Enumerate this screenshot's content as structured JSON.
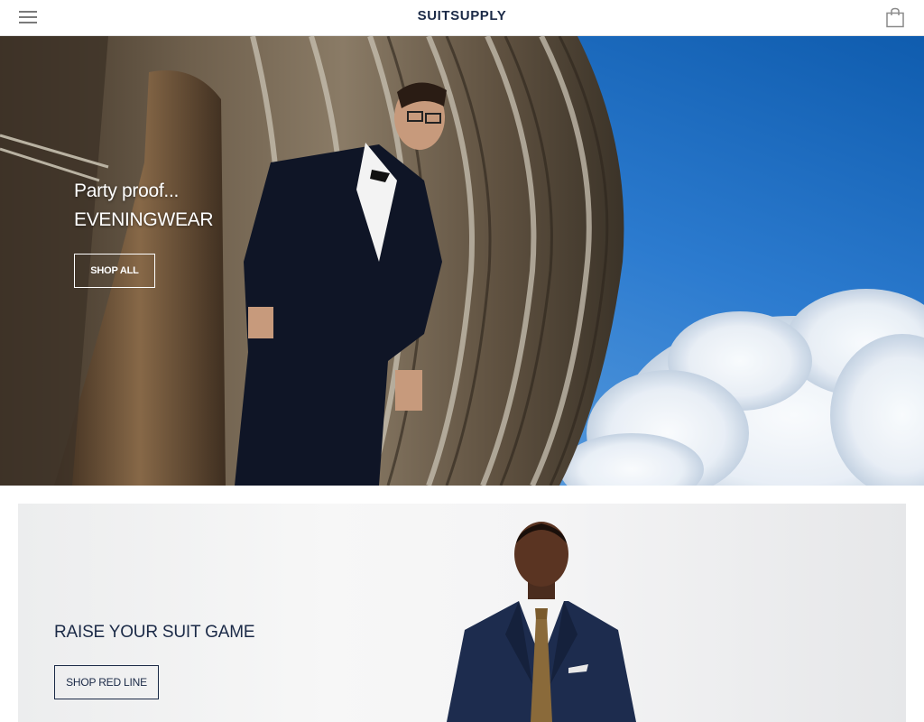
{
  "header": {
    "logo": "SUITSUPPLY",
    "menu_icon": "hamburger-menu-icon",
    "cart_icon": "shopping-bag-icon"
  },
  "hero": {
    "title_line1": "Party proof...",
    "title_line2": "EVENINGWEAR",
    "button_label": "SHOP ALL"
  },
  "banner2": {
    "title": "RAISE YOUR SUIT GAME",
    "button_label": "SHOP RED LINE"
  },
  "colors": {
    "brand_navy": "#1b2a47",
    "sky_blue": "#1f6fc4",
    "hero_text": "#ffffff"
  }
}
